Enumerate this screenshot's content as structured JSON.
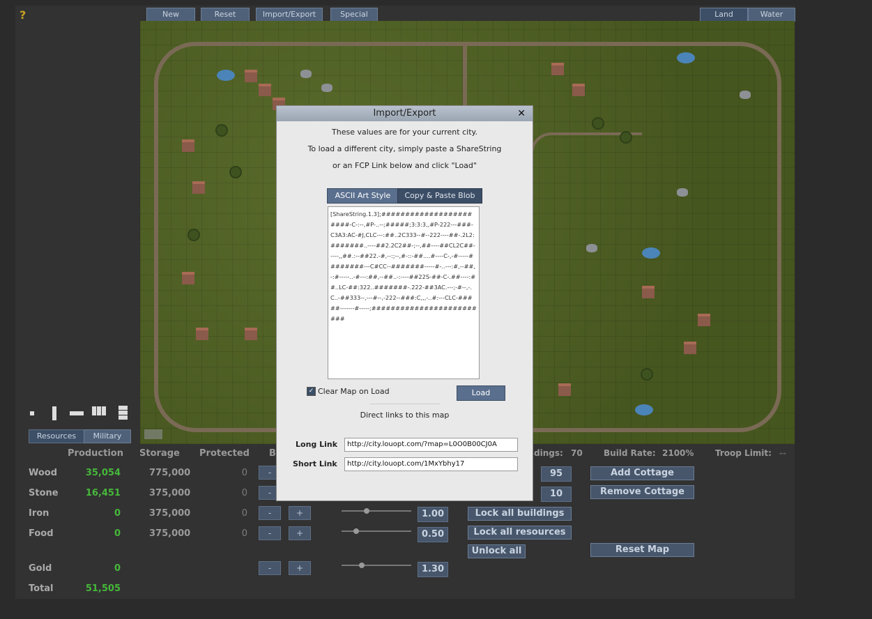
{
  "toolbar": {
    "help": "?",
    "new_label": "New",
    "reset_label": "Reset",
    "import_export_label": "Import/Export",
    "special_label": "Special",
    "land_label": "Land",
    "water_label": "Water"
  },
  "panel_tabs": {
    "resources": "Resources",
    "military": "Military"
  },
  "stats": {
    "headers": {
      "production": "Production",
      "storage": "Storage",
      "protected": "Protected",
      "b": "B"
    },
    "rows": [
      {
        "label": "Wood",
        "production": "35,054",
        "storage": "775,000",
        "protected": "0"
      },
      {
        "label": "Stone",
        "production": "16,451",
        "storage": "375,000",
        "protected": "0"
      },
      {
        "label": "Iron",
        "production": "0",
        "storage": "375,000",
        "protected": "0",
        "rate": "1.00"
      },
      {
        "label": "Food",
        "production": "0",
        "storage": "375,000",
        "protected": "0",
        "rate": "0.50"
      },
      {
        "label": "Gold",
        "production": "0",
        "rate": "1.30"
      },
      {
        "label": "Total",
        "production": "51,505"
      }
    ],
    "minus": "-",
    "plus": "+"
  },
  "info": {
    "buildings_label": "dings:",
    "buildings_value": "70",
    "build_rate_label": "Build Rate:",
    "build_rate_value": "2100%",
    "troop_limit_label": "Troop Limit:",
    "troop_limit_value": "--",
    "wood_box": "95",
    "stone_box": "10"
  },
  "actions": {
    "add_cottage": "Add Cottage",
    "remove_cottage": "Remove Cottage",
    "lock_buildings": "Lock all buildings",
    "lock_resources": "Lock all resources",
    "unlock_all": "Unlock all",
    "reset_map": "Reset Map"
  },
  "modal": {
    "title": "Import/Export",
    "close": "✕",
    "line1": "These values are for your current city.",
    "line2": "To load a different city, simply paste a ShareString",
    "line3": "or an FCP Link below and click \"Load\"",
    "tab_ascii": "ASCII Art Style",
    "tab_blob": "Copy & Paste Blob",
    "blob_text": "[ShareString.1.3];#######################-C-:--,#P-..--;#####;3:3:3,,#P-222---###-C3A3:AC-#J,CLC---:##..2C333--#--222----##-.2L2:#######..----##2.2C2##-;--,##----##CL2C##-----,,##.:--##22.-#,--:;--,#-::-##....#----C-,-#-----########---C#CC--#######-----#-..---:#,--##,-:#-----..-#---:##,--##..-:----##22S-##-C-.##----:##..LC-##:322..#######-.222-##3AC.---;-#--,-.C..-##333--,---#--,-222--###:C,,,-..#:---CLC-#####-------#-----;#########################",
    "clear_label": "Clear Map on Load",
    "clear_check": "✓",
    "load": "Load",
    "direct_links": "Direct links to this map",
    "long_link_label": "Long Link",
    "long_link_value": "http://city.louopt.com/?map=L0O0B00CJ0A",
    "short_link_label": "Short Link",
    "short_link_value": "http://city.louopt.com/1MxYbhy17"
  }
}
